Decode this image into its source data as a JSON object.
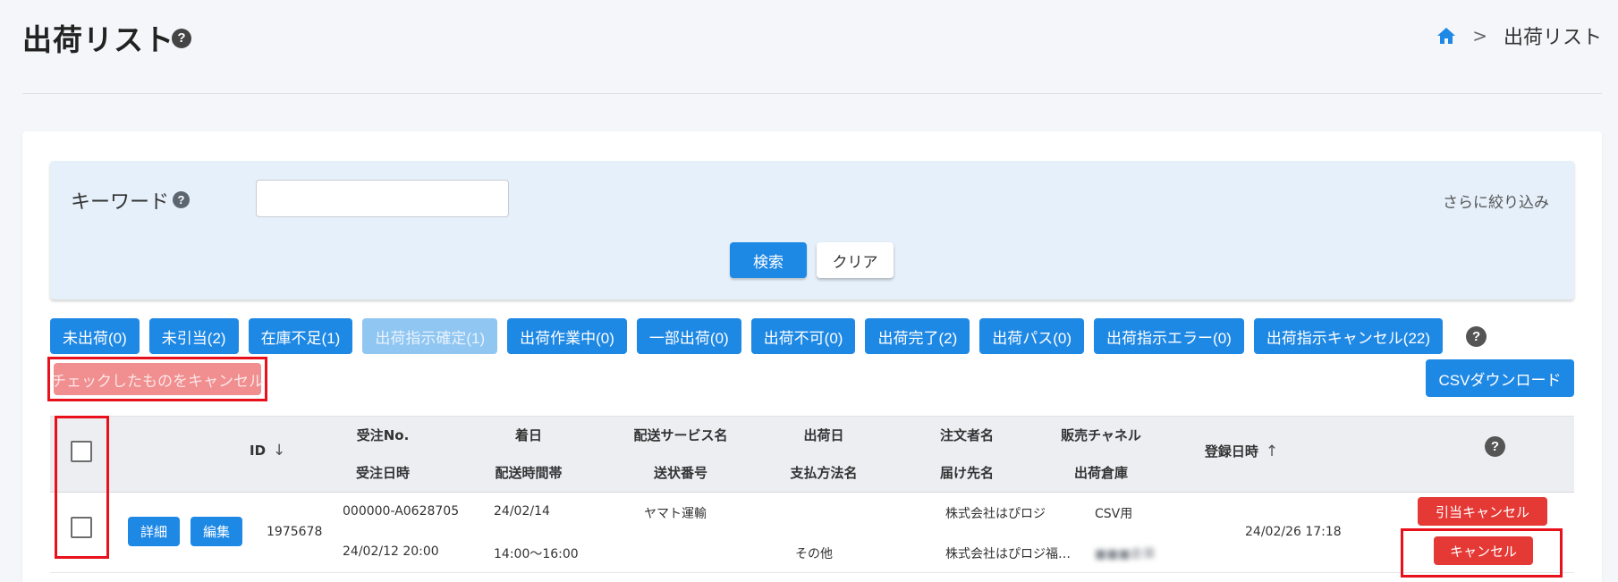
{
  "header": {
    "title": "出荷リスト",
    "title_help_icon": "question-circle-icon",
    "breadcrumb": {
      "home_icon": "home-icon",
      "separator": ">",
      "current": "出荷リスト"
    }
  },
  "search": {
    "keyword_label": "キーワード",
    "keyword_value": "",
    "keyword_placeholder": "",
    "more_filter_label": "さらに絞り込み",
    "search_button": "検索",
    "clear_button": "クリア"
  },
  "status_filters": [
    {
      "label": "未出荷(0)",
      "disabled": false
    },
    {
      "label": "未引当(2)",
      "disabled": false
    },
    {
      "label": "在庫不足(1)",
      "disabled": false
    },
    {
      "label": "出荷指示確定(1)",
      "disabled": true
    },
    {
      "label": "出荷作業中(0)",
      "disabled": false
    },
    {
      "label": "一部出荷(0)",
      "disabled": false
    },
    {
      "label": "出荷不可(0)",
      "disabled": false
    },
    {
      "label": "出荷完了(2)",
      "disabled": false
    },
    {
      "label": "出荷パス(0)",
      "disabled": false
    },
    {
      "label": "出荷指示エラー(0)",
      "disabled": false
    },
    {
      "label": "出荷指示キャンセル(22)",
      "disabled": false
    }
  ],
  "actions": {
    "cancel_checked_label": "チェックしたものをキャンセル",
    "csv_download_label": "CSVダウンロード"
  },
  "table": {
    "headers": {
      "id": "ID",
      "order_no": "受注No.",
      "order_date": "受注日時",
      "arrival_date": "着日",
      "delivery_time": "配送時間帯",
      "delivery_service": "配送サービス名",
      "tracking_no": "送状番号",
      "ship_date": "出荷日",
      "payment_method": "支払方法名",
      "orderer": "注文者名",
      "recipient": "届け先名",
      "sales_channel": "販売チャネル",
      "warehouse": "出荷倉庫",
      "registered_at": "登録日時"
    },
    "rows": [
      {
        "detail_button": "詳細",
        "edit_button": "編集",
        "id": "1975678",
        "order_no": "000000-A0628705",
        "order_date": "24/02/12 20:00",
        "arrival_date": "24/02/14",
        "delivery_time": "14:00～16:00",
        "delivery_service": "ヤマト運輸",
        "tracking_no": "",
        "ship_date": "",
        "payment_method": "その他",
        "orderer": "株式会社はぴロジ",
        "recipient": "株式会社はぴロジ福…",
        "sales_channel": "CSV用",
        "warehouse": "■■■倉庫",
        "registered_at": "24/02/26 17:18",
        "allocation_cancel_button": "引当キャンセル",
        "cancel_button": "キャンセル"
      }
    ]
  },
  "colors": {
    "primary": "#1e88e5",
    "primary_disabled": "#90c6f2",
    "danger": "#e53935",
    "danger_disabled": "#f08e90",
    "highlight_outline": "#e8101a",
    "search_panel_bg": "#e6f0fa"
  }
}
